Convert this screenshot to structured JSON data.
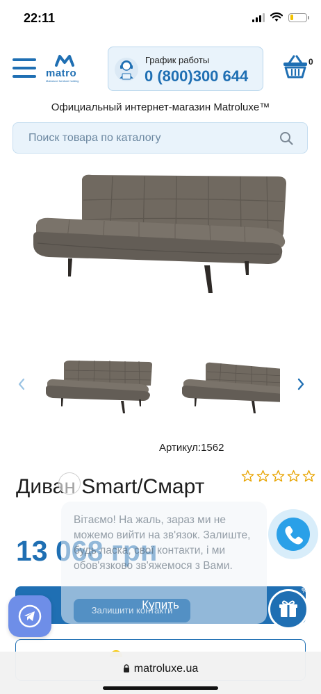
{
  "status_bar": {
    "time": "22:11",
    "battery_level": 0.2
  },
  "header": {
    "logo_text": "matro",
    "logo_tagline": "Matroluxe furniture holding",
    "schedule_label": "График работы",
    "phone": "0 (800)300 644",
    "cart_count": "0"
  },
  "tagline": "Официальный интернет-магазин Matroluxe™",
  "search": {
    "placeholder": "Поиск товара по каталогу"
  },
  "product": {
    "sku_label": "Артикул:",
    "sku_value": "1562",
    "title": "Диван Smart/Смарт",
    "price": "13 068 грн",
    "buy_label": "Купить",
    "rating": 0,
    "rating_max": 5
  },
  "chat": {
    "message": "Вітаємо! На жаль, зараз ми не можемо вийти на зв'язок. Залиште, будь ласка, свої контакти, і ми обов'язково зв'яжемося з Вами.",
    "cta": "Залишити контакти"
  },
  "gift_badge": "%",
  "browser": {
    "address": "matroluxe.ua"
  },
  "colors": {
    "brand_blue": "#1f6fb3",
    "call_blue": "#2aa0e8",
    "telegram": "#6e8ee8",
    "sofa": "#6b645c"
  }
}
